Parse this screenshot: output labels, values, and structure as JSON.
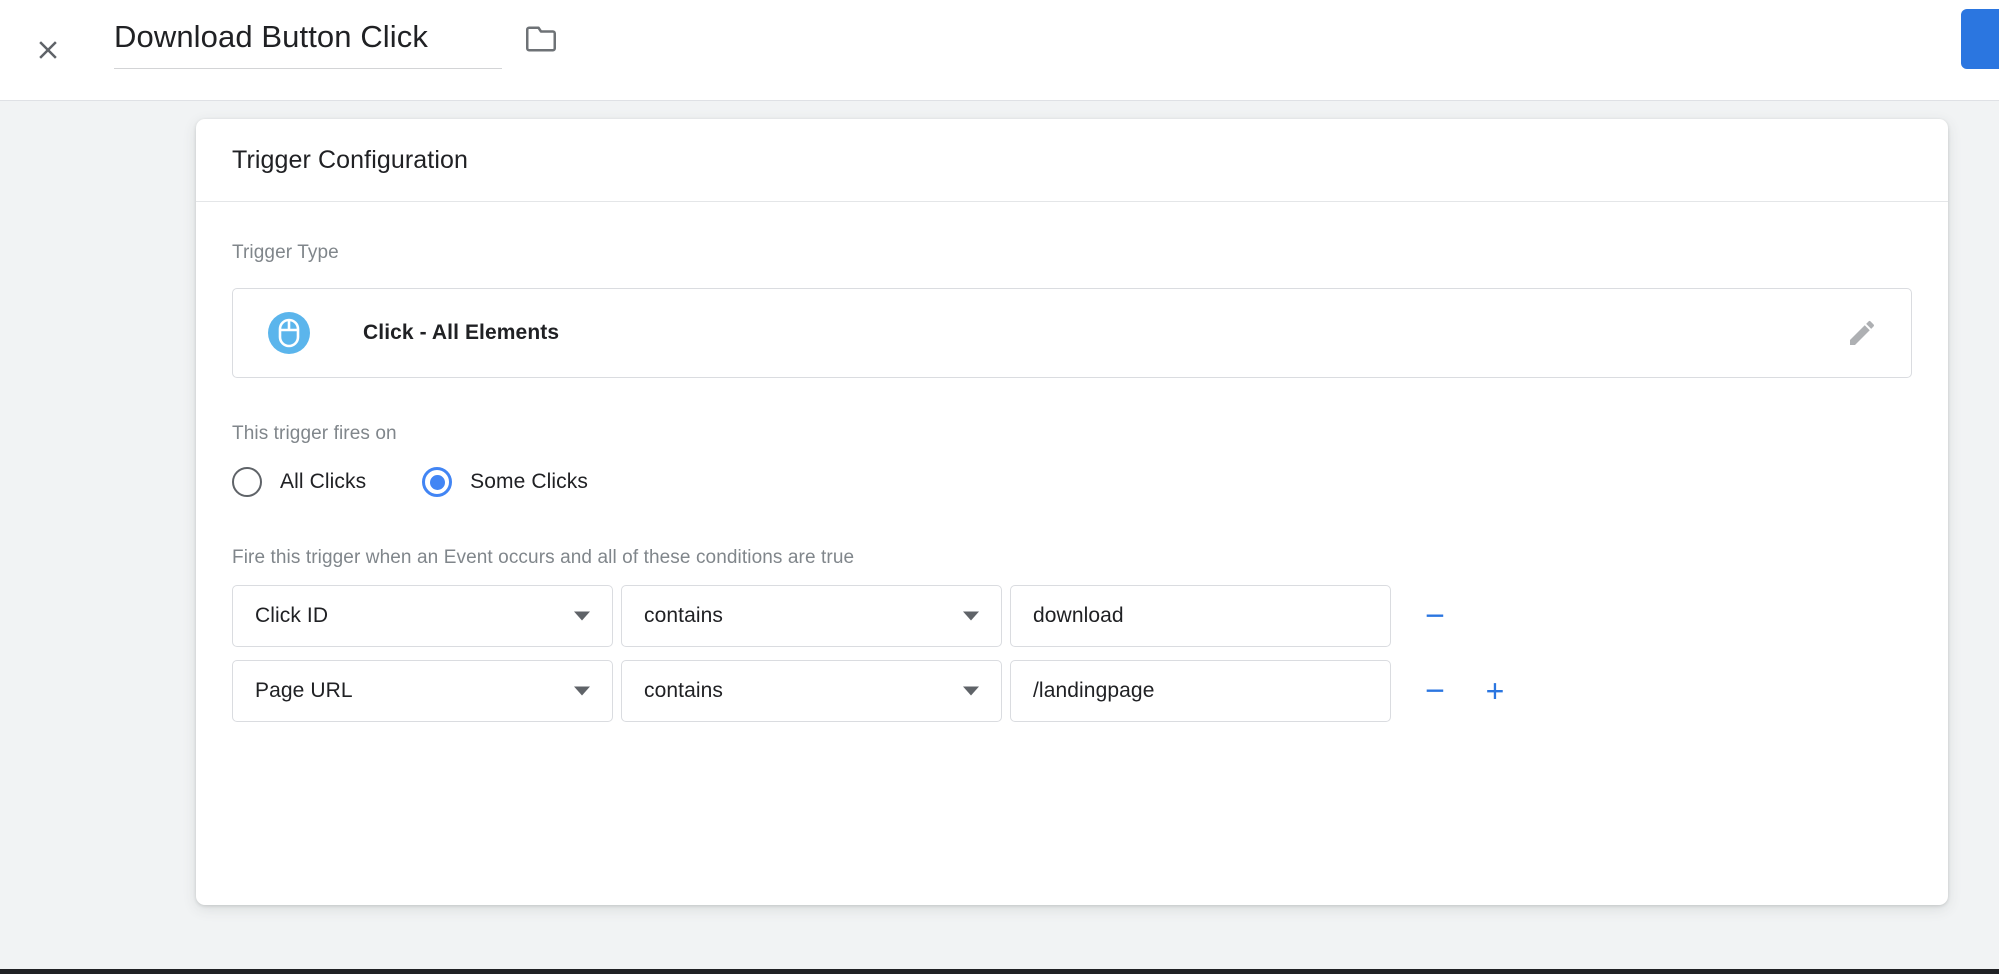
{
  "header": {
    "close_icon": "close-icon",
    "trigger_name": "Download Button Click",
    "folder_icon": "folder-icon",
    "save_button_label": ""
  },
  "card": {
    "title": "Trigger Configuration",
    "trigger_type": {
      "label": "Trigger Type",
      "icon": "mouse-click-icon",
      "icon_color": "#5bb5ec",
      "value": "Click - All Elements",
      "edit_icon": "pencil-icon"
    },
    "fires_on": {
      "label": "This trigger fires on",
      "options": [
        {
          "label": "All Clicks",
          "selected": false
        },
        {
          "label": "Some Clicks",
          "selected": true
        }
      ]
    },
    "conditions": {
      "label": "Fire this trigger when an Event occurs and all of these conditions are true",
      "rows": [
        {
          "variable": "Click ID",
          "operator": "contains",
          "value": "download",
          "remove_label": "−",
          "add_label": "+",
          "has_add": false
        },
        {
          "variable": "Page URL",
          "operator": "contains",
          "value": "/landingpage",
          "remove_label": "−",
          "add_label": "+",
          "has_add": true
        }
      ]
    }
  },
  "colors": {
    "accent_blue": "#2b76e0",
    "radio_blue": "#4285f4",
    "page_background": "#f1f3f4"
  }
}
